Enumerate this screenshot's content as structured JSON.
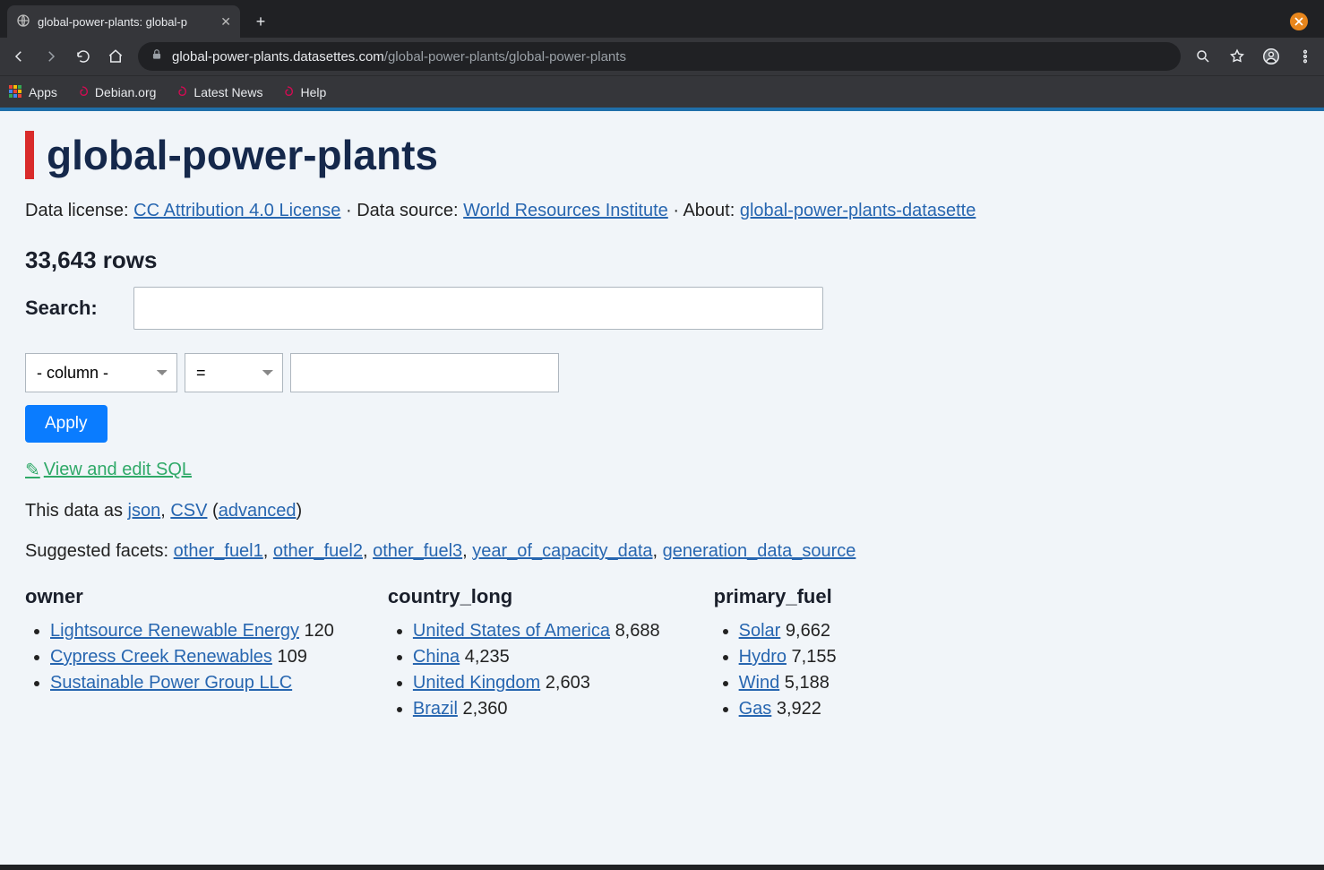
{
  "browser": {
    "tab_title": "global-power-plants: global-p",
    "url_host": "global-power-plants.datasettes.com",
    "url_path": "/global-power-plants/global-power-plants",
    "bookmarks": {
      "apps": "Apps",
      "debian": "Debian.org",
      "latest_news": "Latest News",
      "help": "Help"
    }
  },
  "page": {
    "title": "global-power-plants",
    "meta": {
      "license_label": "Data license: ",
      "license_link": "CC Attribution 4.0 License",
      "source_label": "Data source: ",
      "source_link": "World Resources Institute",
      "about_label": "About: ",
      "about_link": "global-power-plants-datasette"
    },
    "row_count": "33,643 rows",
    "search_label": "Search:",
    "filter": {
      "column_placeholder": "- column -",
      "op_placeholder": "=",
      "apply": "Apply"
    },
    "sql_link": "View and edit SQL",
    "data_as": {
      "prefix": "This data as ",
      "json": "json",
      "csv": "CSV",
      "advanced": "advanced"
    },
    "suggested_facets": {
      "label": "Suggested facets: ",
      "items": [
        "other_fuel1",
        "other_fuel2",
        "other_fuel3",
        "year_of_capacity_data",
        "generation_data_source"
      ]
    },
    "facets": {
      "owner": {
        "heading": "owner",
        "items": [
          {
            "label": "Lightsource Renewable Energy",
            "count": "120"
          },
          {
            "label": "Cypress Creek Renewables",
            "count": "109"
          },
          {
            "label": "Sustainable Power Group LLC",
            "count": ""
          }
        ]
      },
      "country_long": {
        "heading": "country_long",
        "items": [
          {
            "label": "United States of America",
            "count": "8,688"
          },
          {
            "label": "China",
            "count": "4,235"
          },
          {
            "label": "United Kingdom",
            "count": "2,603"
          },
          {
            "label": "Brazil",
            "count": "2,360"
          }
        ]
      },
      "primary_fuel": {
        "heading": "primary_fuel",
        "items": [
          {
            "label": "Solar",
            "count": "9,662"
          },
          {
            "label": "Hydro",
            "count": "7,155"
          },
          {
            "label": "Wind",
            "count": "5,188"
          },
          {
            "label": "Gas",
            "count": "3,922"
          }
        ]
      }
    }
  }
}
